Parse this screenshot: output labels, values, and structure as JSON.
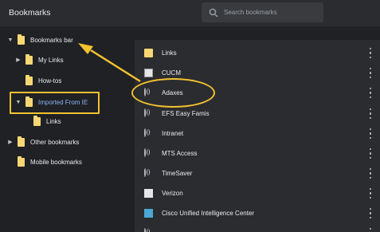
{
  "header": {
    "title": "Bookmarks",
    "search": {
      "placeholder": "Search bookmarks",
      "icon": "search-icon"
    }
  },
  "sidebar": {
    "items": [
      {
        "label": "Bookmarks bar",
        "expanded": true,
        "icon": "folder-icon"
      },
      {
        "label": "My Links",
        "expanded": false,
        "icon": "folder-icon"
      },
      {
        "label": "How-tos",
        "icon": "folder-icon"
      },
      {
        "label": "Imported From IE",
        "expanded": true,
        "selected": true,
        "icon": "folder-icon"
      },
      {
        "label": "Links",
        "icon": "folder-icon"
      },
      {
        "label": "Other bookmarks",
        "expanded": false,
        "icon": "folder-icon"
      },
      {
        "label": "Mobile bookmarks",
        "icon": "folder-icon"
      }
    ]
  },
  "list": {
    "items": [
      {
        "label": "Links",
        "icon": "folder-icon"
      },
      {
        "label": "CUCM",
        "icon": "cucm-favicon"
      },
      {
        "label": "Adaxes",
        "icon": "globe-icon"
      },
      {
        "label": "EFS Easy Famis",
        "icon": "globe-icon"
      },
      {
        "label": "Intranet",
        "icon": "globe-icon"
      },
      {
        "label": "MTS Access",
        "icon": "globe-icon"
      },
      {
        "label": "TimeSaver",
        "icon": "globe-icon"
      },
      {
        "label": "Verizon",
        "icon": "verizon-favicon"
      },
      {
        "label": "Cisco Unified Intelligence Center",
        "icon": "cisco-favicon"
      }
    ]
  },
  "colors": {
    "background": "#202124",
    "panel": "#2b2c2f",
    "selected_text": "#8ab4f8",
    "folder": "#f7d774",
    "annotation": "#f2c230"
  }
}
